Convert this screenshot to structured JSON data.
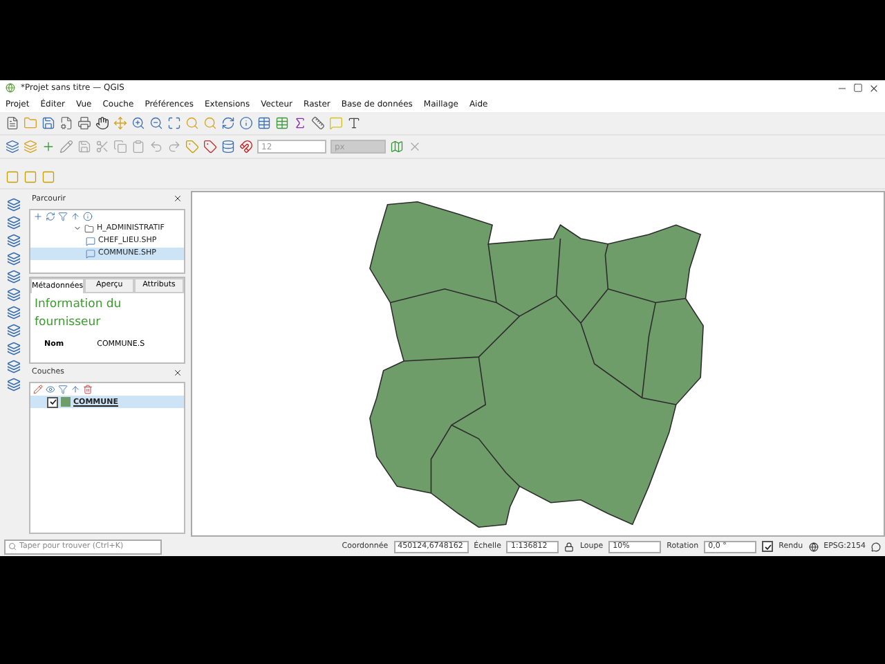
{
  "window": {
    "title": "*Projet sans titre — QGIS"
  },
  "menu": [
    "Projet",
    "Éditer",
    "Vue",
    "Couche",
    "Préférences",
    "Extensions",
    "Vecteur",
    "Raster",
    "Base de données",
    "Maillage",
    "Aide"
  ],
  "toolbar": {
    "size_value": "12",
    "unit_value": "px"
  },
  "browser": {
    "title": "Parcourir",
    "tree": [
      {
        "label": "H_ADMINISTRATIF",
        "expanded": true,
        "selected": false,
        "children": [
          {
            "label": "CHEF_LIEU.SHP",
            "selected": false
          },
          {
            "label": "COMMUNE.SHP",
            "selected": true
          }
        ]
      }
    ]
  },
  "info": {
    "tabs": [
      {
        "label": "Métadonnées",
        "selected": true
      },
      {
        "label": "Aperçu",
        "selected": false
      },
      {
        "label": "Attributs",
        "selected": false
      }
    ],
    "heading": "Information du fournisseur",
    "rows": [
      {
        "key": "Nom",
        "value": "COMMUNE.S"
      }
    ]
  },
  "layers": {
    "title": "Couches",
    "items": [
      {
        "label": "COMMUNE",
        "checked": true,
        "selected": true,
        "color": "#6f9d6a"
      }
    ]
  },
  "status": {
    "search_placeholder": "Taper pour trouver (Ctrl+K)",
    "coord_label": "Coordonnée",
    "coord_value": "450124,6748162",
    "scale_label": "Échelle",
    "scale_value": "1:136812",
    "magnifier_label": "Loupe",
    "magnifier_value": "10%",
    "rotation_label": "Rotation",
    "rotation_value": "0,0 °",
    "render_label": "Rendu",
    "render_checked": true,
    "crs": "EPSG:2154"
  }
}
